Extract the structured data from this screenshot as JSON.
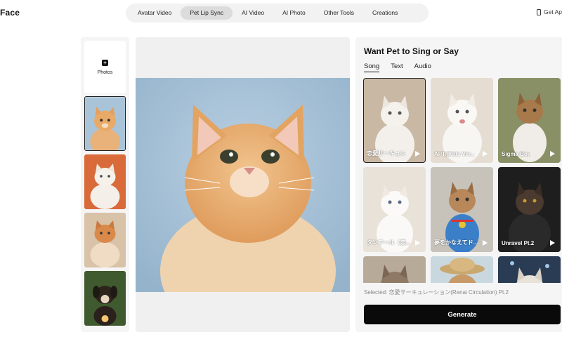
{
  "header": {
    "logo_text": "Face",
    "nav": [
      {
        "label": "Avatar Video",
        "active": false
      },
      {
        "label": "Pet Lip Sync",
        "active": true
      },
      {
        "label": "AI Video",
        "active": false
      },
      {
        "label": "AI Photo",
        "active": false
      },
      {
        "label": "Other Tools",
        "active": false
      },
      {
        "label": "Creations",
        "active": false
      }
    ],
    "get_app_label": "Get Ap"
  },
  "thumbs": {
    "photos_label": "Photos",
    "items": [
      {
        "kind": "orange-cat",
        "selected": true
      },
      {
        "kind": "white-cat",
        "selected": false
      },
      {
        "kind": "tabby-cat",
        "selected": false
      },
      {
        "kind": "puppy",
        "selected": false
      }
    ]
  },
  "panel": {
    "title": "Want Pet to Sing or Say",
    "tabs": [
      {
        "label": "Song",
        "active": true
      },
      {
        "label": "Text",
        "active": false
      },
      {
        "label": "Audio",
        "active": false
      }
    ],
    "songs": [
      {
        "label": "恋愛サーキュレ",
        "selected": true
      },
      {
        "label": "APT.(Kids Ver...",
        "selected": false
      },
      {
        "label": "Sigma Boy",
        "selected": false
      },
      {
        "label": "タンフール（恋...",
        "selected": false
      },
      {
        "label": "夢をかなえてド...",
        "selected": false
      },
      {
        "label": "Unravel Pt.2",
        "selected": false
      },
      {
        "label": "",
        "selected": false
      },
      {
        "label": "",
        "selected": false
      },
      {
        "label": "",
        "selected": false
      }
    ],
    "selected_text": "Selected: 恋愛サーキュレーション(Renai Circulation) Pt.2",
    "generate_label": "Generate"
  },
  "colors": {
    "accent": "#0a0a0a",
    "panel_bg": "#f5f5f5",
    "nav_bg": "#f2f2f2"
  }
}
